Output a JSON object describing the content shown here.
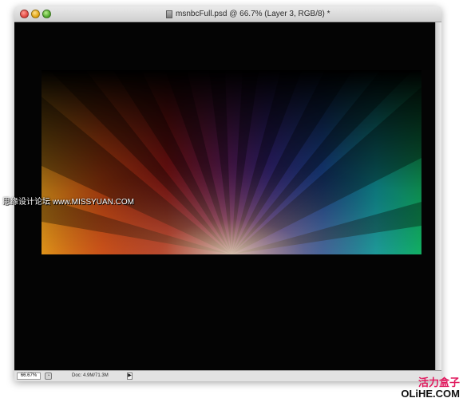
{
  "window": {
    "title": "msnbcFull.psd @ 66.7% (Layer 3, RGB/8) *"
  },
  "status": {
    "zoom": "66.67%",
    "doc_size": "Doc: 4.9M/71.3M"
  },
  "watermarks": {
    "left": "思缘设计论坛 www.MISSYUAN.COM",
    "right_cn": "活力盒子",
    "right_url": "OLiHE.COM"
  },
  "icons": {
    "status_icon": "status-info-icon",
    "status_arrow": "status-arrow-icon",
    "document": "document-icon"
  },
  "colors": {
    "canvas_bg": "#040404",
    "watermark_pink": "#e0185d"
  }
}
